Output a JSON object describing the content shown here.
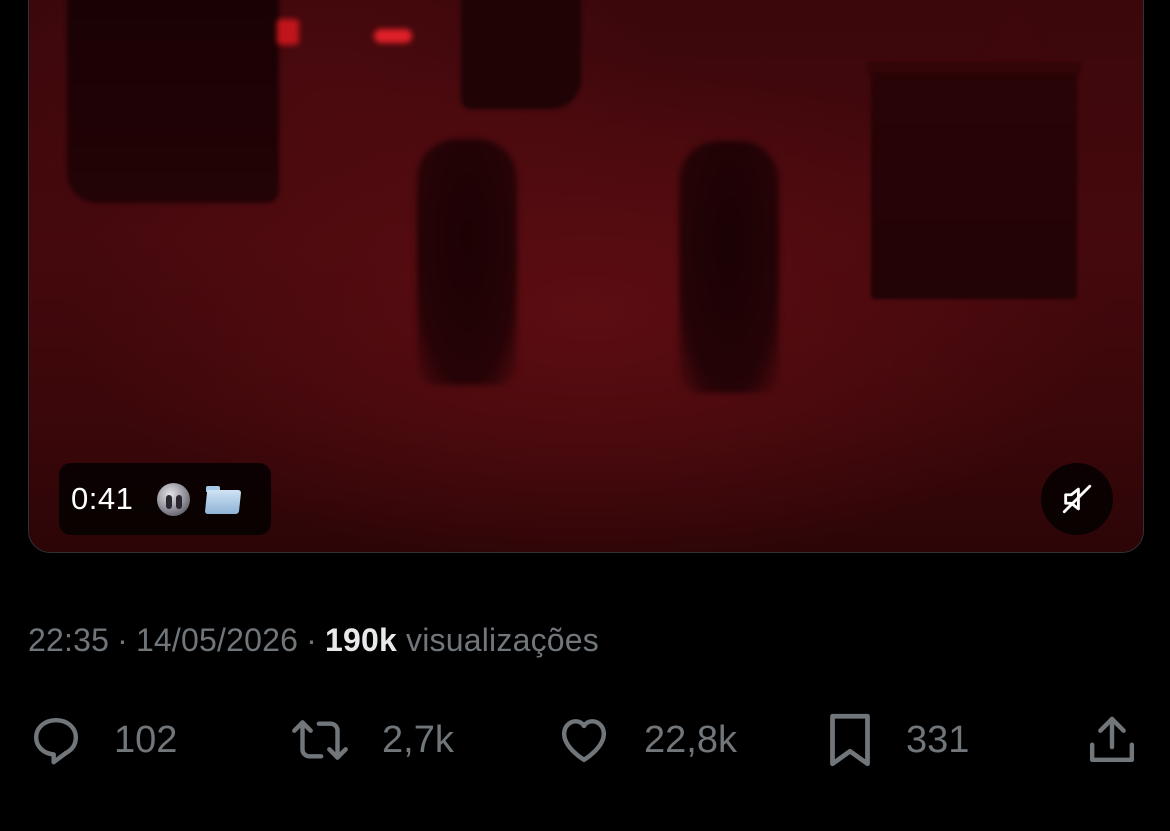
{
  "video": {
    "duration": "0:41",
    "overlay_icons": [
      "profile-thumbnail-icon",
      "folder-icon"
    ],
    "muted": true
  },
  "tweet_meta": {
    "time": "22:35",
    "separator": "·",
    "date": "14/05/2026",
    "views_count": "190k",
    "views_label": "visualizações"
  },
  "actions": {
    "reply": {
      "icon": "reply-icon",
      "count": "102"
    },
    "retweet": {
      "icon": "retweet-icon",
      "count": "2,7k"
    },
    "like": {
      "icon": "heart-icon",
      "count": "22,8k"
    },
    "bookmark": {
      "icon": "bookmark-icon",
      "count": "331"
    },
    "share": {
      "icon": "share-icon"
    }
  },
  "colors": {
    "background": "#000000",
    "muted_text": "#71767b",
    "bright_text": "#e7e9ea",
    "card_border": "#2f3336",
    "video_tint": "#4a0a0e"
  }
}
